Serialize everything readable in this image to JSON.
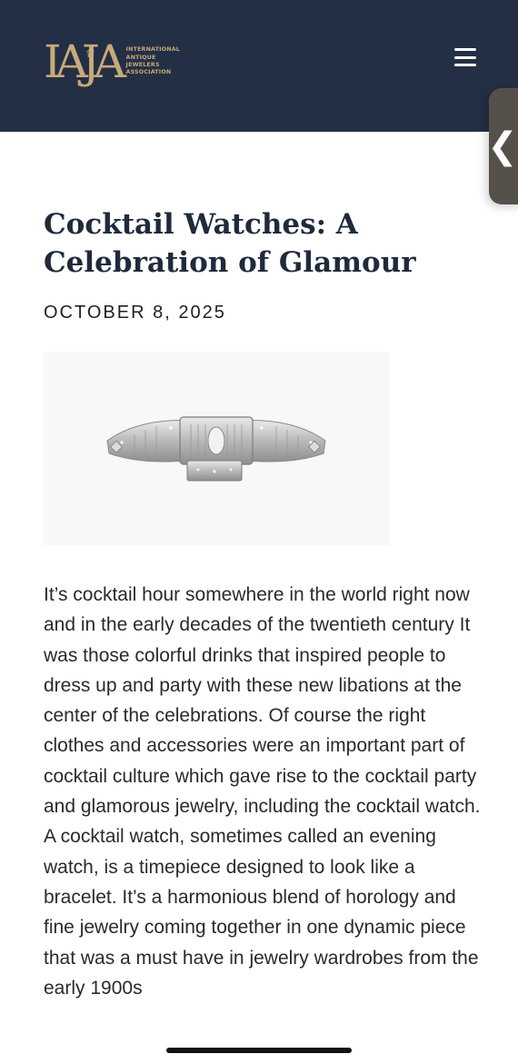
{
  "header": {
    "logo_mark": "IAJA",
    "logo_text": [
      "INTERNATIONAL",
      "ANTIQUE",
      "JEWELERS",
      "ASSOCIATION"
    ],
    "menu_icon": "hamburger-menu-icon"
  },
  "side_tab": {
    "icon": "chevron-left-icon",
    "glyph": "❮"
  },
  "article": {
    "title": "Cocktail Watches: A Celebration of Glamour",
    "date": "OCTOBER 8, 2025",
    "image_subject": "diamond cocktail watch bracelet",
    "body": "It’s cocktail hour somewhere in the world right now and in the early decades of the twentieth century It was those colorful drinks that inspired people to dress up and party with these new libations at the center of the celebrations. Of course the right clothes and accessories were an important part of cocktail culture which gave rise to the cocktail party and glamorous jewelry, including the cocktail watch. A cocktail watch, sometimes called an evening watch, is a timepiece designed to look like a bracelet. It’s a harmonious blend of horology and fine jewelry coming together in one dynamic piece that was a must have in jewelry wardrobes from the early 1900s"
  },
  "colors": {
    "header_bg": "#232f45",
    "logo_gold": "#c7aa79",
    "title_navy": "#1f2a3c",
    "side_tab_bg": "#55504a"
  }
}
